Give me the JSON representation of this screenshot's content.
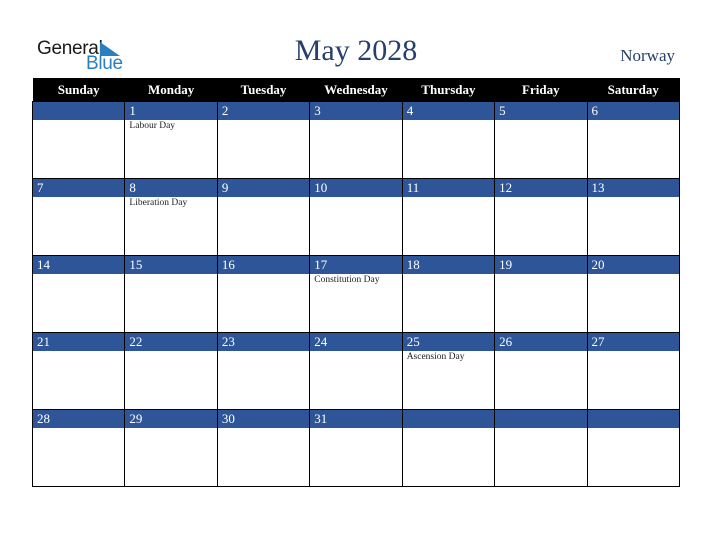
{
  "logo": {
    "word1": "General",
    "word2": "Blue"
  },
  "title": "May 2028",
  "country": "Norway",
  "colors": {
    "header_bg": "#000000",
    "day_bar": "#2e5597",
    "title": "#27406b",
    "logo_blue": "#2a7fc1"
  },
  "weekdays": [
    "Sunday",
    "Monday",
    "Tuesday",
    "Wednesday",
    "Thursday",
    "Friday",
    "Saturday"
  ],
  "weeks": [
    {
      "days": [
        "",
        "1",
        "2",
        "3",
        "4",
        "5",
        "6"
      ],
      "events": [
        "",
        "Labour Day",
        "",
        "",
        "",
        "",
        ""
      ]
    },
    {
      "days": [
        "7",
        "8",
        "9",
        "10",
        "11",
        "12",
        "13"
      ],
      "events": [
        "",
        "Liberation Day",
        "",
        "",
        "",
        "",
        ""
      ]
    },
    {
      "days": [
        "14",
        "15",
        "16",
        "17",
        "18",
        "19",
        "20"
      ],
      "events": [
        "",
        "",
        "",
        "Constitution Day",
        "",
        "",
        ""
      ]
    },
    {
      "days": [
        "21",
        "22",
        "23",
        "24",
        "25",
        "26",
        "27"
      ],
      "events": [
        "",
        "",
        "",
        "",
        "Ascension Day",
        "",
        ""
      ]
    },
    {
      "days": [
        "28",
        "29",
        "30",
        "31",
        "",
        "",
        ""
      ],
      "events": [
        "",
        "",
        "",
        "",
        "",
        "",
        ""
      ]
    }
  ]
}
